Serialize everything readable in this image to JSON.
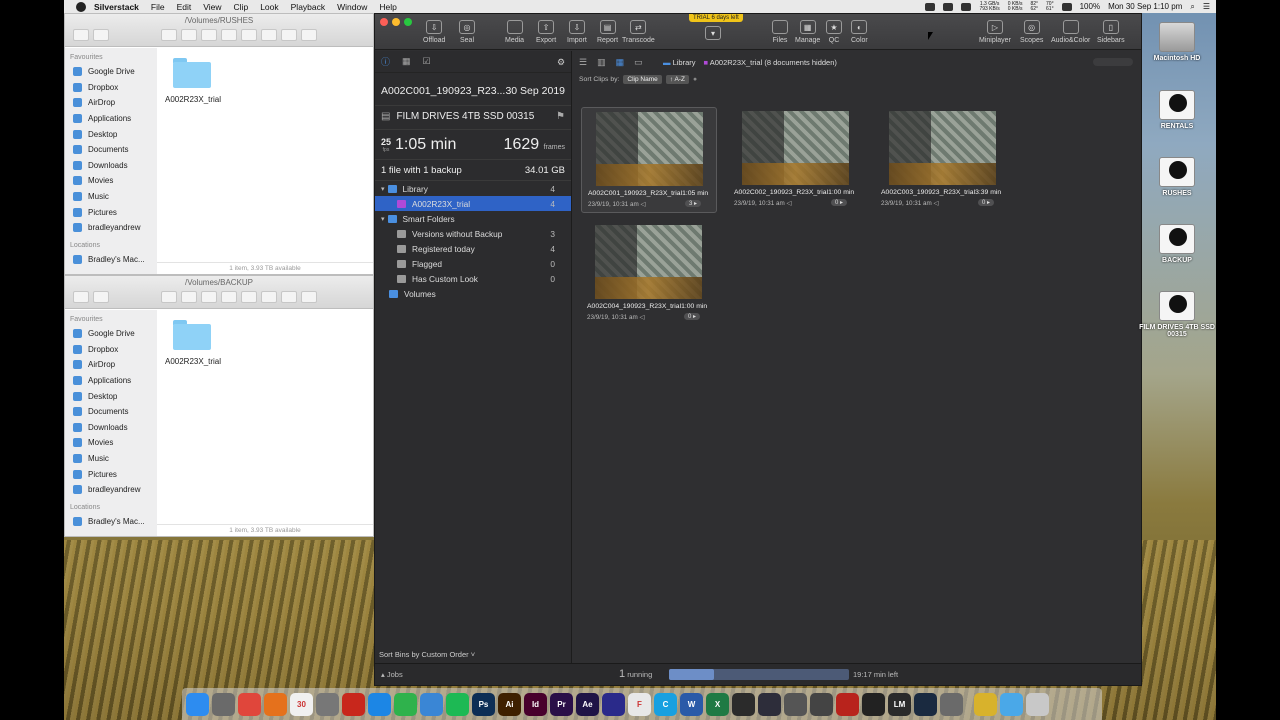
{
  "menubar": {
    "app": "Silverstack",
    "items": [
      "File",
      "Edit",
      "View",
      "Clip",
      "Look",
      "Playback",
      "Window",
      "Help"
    ],
    "net_up": "1.3 GB/s",
    "net_down": "793 KB/s",
    "io_read": "0 KB/s",
    "io_write": "0 KB/s",
    "temp_cpu": "82°",
    "temp_gpu": "62°",
    "fan": "70°",
    "fan2": "61°",
    "battery": "100%",
    "datetime": "Mon 30 Sep  1:10 pm"
  },
  "finder_top": {
    "title": "/Volumes/RUSHES",
    "favourites_header": "Favourites",
    "favourites": [
      "Google Drive",
      "Dropbox",
      "AirDrop",
      "Applications",
      "Desktop",
      "Documents",
      "Downloads",
      "Movies",
      "Music",
      "Pictures",
      "bradleyandrew"
    ],
    "locations_header": "Locations",
    "locations": [
      "Bradley's Mac..."
    ],
    "folder": "A002R23X_trial",
    "status": "1 item, 3.93 TB available"
  },
  "finder_bottom": {
    "title": "/Volumes/BACKUP",
    "favourites_header": "Favourites",
    "favourites": [
      "Google Drive",
      "Dropbox",
      "AirDrop",
      "Applications",
      "Desktop",
      "Documents",
      "Downloads",
      "Movies",
      "Music",
      "Pictures",
      "bradleyandrew"
    ],
    "locations_header": "Locations",
    "locations": [
      "Bradley's Mac..."
    ],
    "folder": "A002R23X_trial",
    "status": "1 item, 3.93 TB available"
  },
  "silverstack": {
    "trial_badge": "TRIAL 6 days left",
    "toolbar_left": [
      "Offload",
      "Seal",
      "Media",
      "Export",
      "Import",
      "Report",
      "Transcode"
    ],
    "toolbar_mid": [
      "Files",
      "Manage",
      "QC",
      "Color"
    ],
    "toolbar_right": [
      "Miniplayer",
      "Scopes",
      "Audio&Color",
      "Sidebars"
    ],
    "info": {
      "clip_name": "A002C001_190923_R23...",
      "date": "30 Sep 2019",
      "volume": "FILM DRIVES 4TB SSD 00315",
      "fps": "25",
      "fps_unit": "fps",
      "duration": "1:05 min",
      "frames": "1629",
      "frames_unit": "frames",
      "backup": "1 file with 1 backup",
      "size": "34.01 GB"
    },
    "tree": [
      {
        "label": "Library",
        "count": "4",
        "level": 0,
        "color": "#4a8fe0"
      },
      {
        "label": "A002R23X_trial",
        "count": "4",
        "level": 1,
        "color": "#b04ad8",
        "selected": true
      },
      {
        "label": "Smart Folders",
        "count": "",
        "level": 0,
        "color": "#4a8fe0"
      },
      {
        "label": "Versions without Backup",
        "count": "3",
        "level": 1,
        "color": "#9a9a9a"
      },
      {
        "label": "Registered today",
        "count": "4",
        "level": 1,
        "color": "#9a9a9a"
      },
      {
        "label": "Flagged",
        "count": "0",
        "level": 1,
        "color": "#9a9a9a"
      },
      {
        "label": "Has Custom Look",
        "count": "0",
        "level": 1,
        "color": "#9a9a9a"
      },
      {
        "label": "Volumes",
        "count": "",
        "level": 0,
        "color": "#4a8fe0"
      }
    ],
    "sort_bins": "Sort Bins by Custom Order ˅",
    "breadcrumb_library": "Library",
    "breadcrumb_bin": "A002R23X_trial (8 documents hidden)",
    "sort_clips_label": "Sort Clips by:",
    "sort_field": "Clip Name",
    "sort_dir": "↑ A-Z",
    "clips": [
      {
        "name": "A002C001_190923_R23X_trial",
        "duration": "1:05 min",
        "date": "23/9/19, 10:31 am",
        "count": "3 ▸",
        "selected": true
      },
      {
        "name": "A002C002_190923_R23X_trial",
        "duration": "1:00 min",
        "date": "23/9/19, 10:31 am",
        "count": "0 ▸",
        "selected": false
      },
      {
        "name": "A002C003_190923_R23X_trial",
        "duration": "3:39 min",
        "date": "23/9/19, 10:31 am",
        "count": "0 ▸",
        "selected": false
      },
      {
        "name": "A002C004_190923_R23X_trial",
        "duration": "1:00 min",
        "date": "23/9/19, 10:31 am",
        "count": "0 ▸",
        "selected": false
      }
    ],
    "jobs": {
      "label": "Jobs",
      "running_count": "1",
      "running_label": "running",
      "progress": 0.25,
      "time_left": "19:17 min left"
    }
  },
  "desktop_drives": [
    "Macintosh HD",
    "RENTALS",
    "RUSHES",
    "BACKUP",
    "FILM DRIVES 4TB SSD 00315"
  ],
  "dock": [
    {
      "icon": "finder-icon",
      "color": "#2d8cf0",
      "text": ""
    },
    {
      "icon": "photos-icon",
      "color": "#6a6a6a",
      "text": ""
    },
    {
      "icon": "chrome-icon",
      "color": "#e0463b",
      "text": ""
    },
    {
      "icon": "firefox-icon",
      "color": "#e5711c",
      "text": ""
    },
    {
      "icon": "calendar-icon",
      "color": "#f0f0f0",
      "text": "30"
    },
    {
      "icon": "scripts-icon",
      "color": "#777",
      "text": ""
    },
    {
      "icon": "acrobat-icon",
      "color": "#c8271c",
      "text": ""
    },
    {
      "icon": "appstore-icon",
      "color": "#1c86e5",
      "text": ""
    },
    {
      "icon": "messages-icon",
      "color": "#2fb24c",
      "text": ""
    },
    {
      "icon": "preview-icon",
      "color": "#3a86d5",
      "text": ""
    },
    {
      "icon": "spotify-icon",
      "color": "#1db954",
      "text": ""
    },
    {
      "icon": "photoshop-icon",
      "color": "#0d2e55",
      "text": "Ps"
    },
    {
      "icon": "illustrator-icon",
      "color": "#3e2000",
      "text": "Ai"
    },
    {
      "icon": "indesign-icon",
      "color": "#48002c",
      "text": "Id"
    },
    {
      "icon": "premiere-icon",
      "color": "#2a0f48",
      "text": "Pr"
    },
    {
      "icon": "aftereffects-icon",
      "color": "#1f1446",
      "text": "Ae"
    },
    {
      "icon": "screenflow-icon",
      "color": "#2a2a8a",
      "text": ""
    },
    {
      "icon": "framer-icon",
      "color": "#e8e8e8",
      "text": "F"
    },
    {
      "icon": "codeapp-icon",
      "color": "#18a0e0",
      "text": "C"
    },
    {
      "icon": "word-icon",
      "color": "#2a5aa8",
      "text": "W"
    },
    {
      "icon": "excel-icon",
      "color": "#1f7a44",
      "text": "X"
    },
    {
      "icon": "terminal-icon",
      "color": "#2b2b2b",
      "text": ""
    },
    {
      "icon": "resolve-icon",
      "color": "#2d2d3a",
      "text": ""
    },
    {
      "icon": "compressor-icon",
      "color": "#555",
      "text": ""
    },
    {
      "icon": "clapper-icon",
      "color": "#444",
      "text": ""
    },
    {
      "icon": "record-icon",
      "color": "#b8231c",
      "text": ""
    },
    {
      "icon": "plex-icon",
      "color": "#222",
      "text": ""
    },
    {
      "icon": "lm-icon",
      "color": "#2a2a2a",
      "text": "LM"
    },
    {
      "icon": "steam-icon",
      "color": "#1a2a40",
      "text": ""
    },
    {
      "icon": "system-prefs-icon",
      "color": "#6a6a6a",
      "text": ""
    },
    {
      "icon": "silverstack-icon",
      "color": "#d8b22c",
      "text": ""
    },
    {
      "icon": "downloads-folder-icon",
      "color": "#4aa8e8",
      "text": ""
    },
    {
      "icon": "trash-icon",
      "color": "#c8c8c8",
      "text": ""
    }
  ]
}
